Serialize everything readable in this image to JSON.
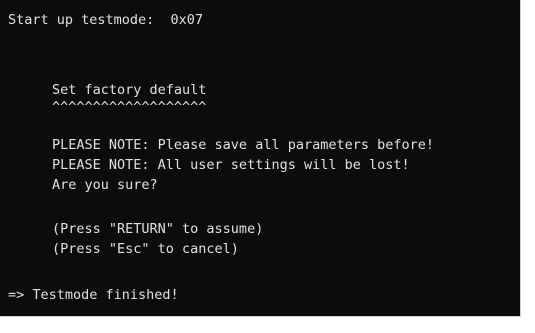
{
  "console": {
    "lines": {
      "startup": "Start up testmode:  0x07",
      "heading": "Set factory default",
      "underline": "^^^^^^^^^^^^^^^^^^^",
      "note1": "PLEASE NOTE: Please save all parameters before!",
      "note2": "PLEASE NOTE: All user settings will be lost!",
      "question": "Are you sure?",
      "press_return": "(Press \"RETURN\" to assume)",
      "press_esc": "(Press \"Esc\" to cancel)",
      "finished": "=> Testmode finished!"
    },
    "colors": {
      "background": "#0c0c0c",
      "text": "#e0e0e0"
    }
  }
}
